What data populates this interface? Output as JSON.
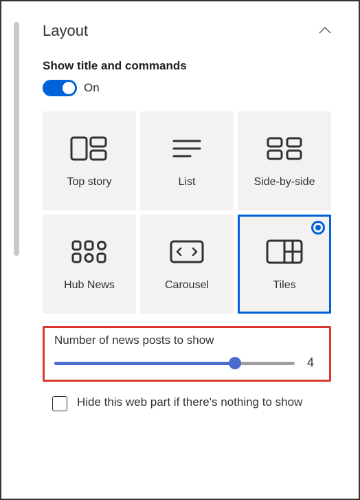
{
  "section": {
    "title": "Layout"
  },
  "toggle": {
    "label": "Show title and commands",
    "state": "On"
  },
  "layouts": [
    {
      "label": "Top story"
    },
    {
      "label": "List"
    },
    {
      "label": "Side-by-side"
    },
    {
      "label": "Hub News"
    },
    {
      "label": "Carousel"
    },
    {
      "label": "Tiles"
    }
  ],
  "slider": {
    "label": "Number of news posts to show",
    "value": "4"
  },
  "checkbox": {
    "label": "Hide this web part if there's nothing to show"
  }
}
